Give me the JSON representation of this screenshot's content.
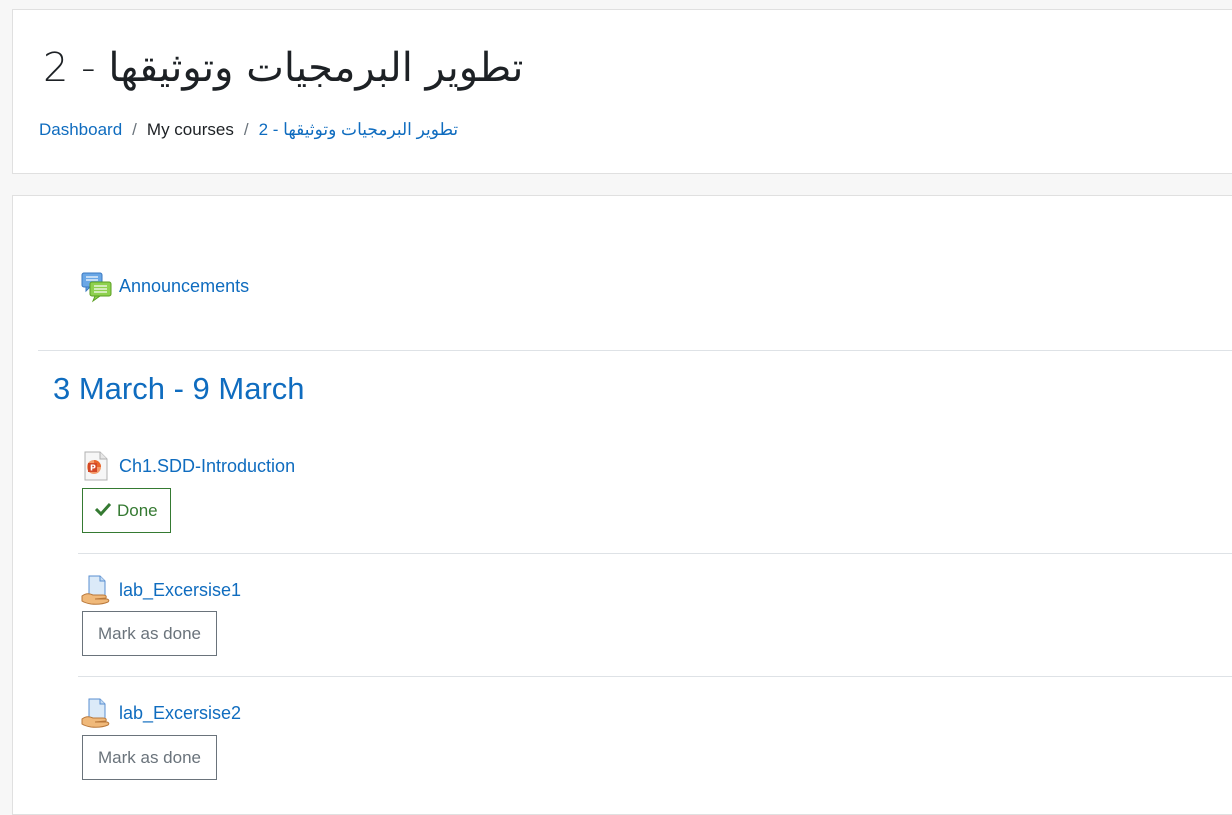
{
  "header": {
    "title": "تطوير البرمجيات وتوثيقها - 2",
    "breadcrumb": {
      "dashboard": "Dashboard",
      "my_courses": "My courses",
      "course": "تطوير البرمجيات وتوثيقها - 2",
      "separator": "/"
    }
  },
  "general_section": {
    "announcements": {
      "label": "Announcements",
      "icon": "forum-icon"
    }
  },
  "section": {
    "title": "3 March - 9 March",
    "activities": [
      {
        "label": "Ch1.SDD-Introduction",
        "icon": "powerpoint-file-icon",
        "completion": "Done"
      },
      {
        "label": "lab_Excersise1",
        "icon": "assignment-icon",
        "completion": "Mark as done"
      },
      {
        "label": "lab_Excersise2",
        "icon": "assignment-icon",
        "completion": "Mark as done"
      }
    ]
  },
  "colors": {
    "link": "#0f6cbf",
    "done": "#357a32",
    "mark": "#6a737b"
  }
}
